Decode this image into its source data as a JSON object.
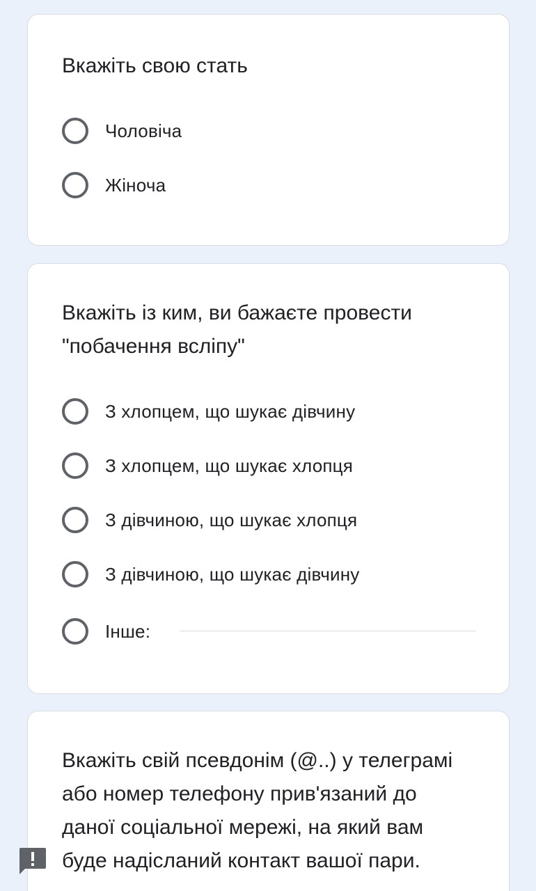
{
  "q1": {
    "title": "Вкажіть свою стать",
    "options": [
      "Чоловіча",
      "Жіноча"
    ]
  },
  "q2": {
    "title_line1": "Вкажіть із ким, ви бажаєте провести",
    "title_line2": "\"побачення всліпу\"",
    "options": [
      "З хлопцем, що шукає дівчину",
      "З хлопцем, що шукає хлопця",
      "З дівчиною, що шукає хлопця",
      "З дівчиною, що шукає дівчину"
    ],
    "other_label": "Інше:",
    "other_value": ""
  },
  "q3": {
    "lines": [
      "Вкажіть свій псевдонім (@..) у телеграмі",
      "або номер телефону прив'язаний до",
      "даної соціальної мережі, на який вам",
      "буде надісланий контакт вашої пари."
    ]
  },
  "icons": {
    "radio": "radio-unchecked-icon",
    "report": "report-issue-icon"
  },
  "colors": {
    "background": "#eaf1fb",
    "card": "#ffffff",
    "radio_border": "#5f6368",
    "text": "#202124",
    "report_icon": "#5f6368"
  }
}
